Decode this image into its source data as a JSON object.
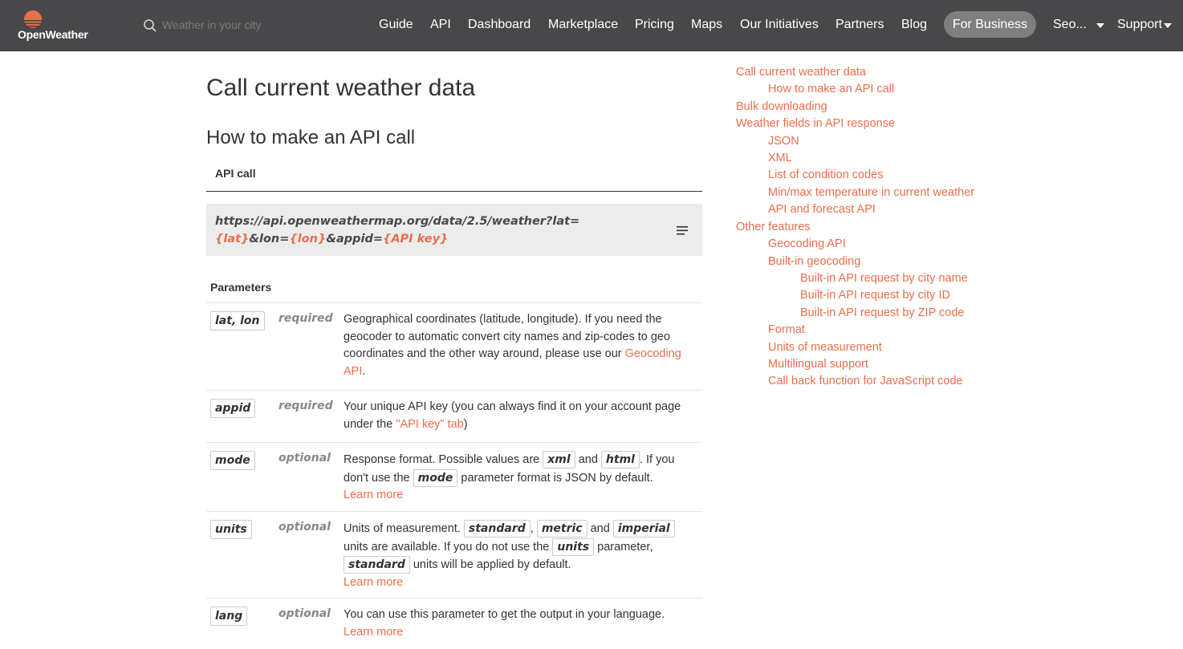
{
  "header": {
    "logo_text": "OpenWeather",
    "search_placeholder": "Weather in your city",
    "nav": [
      "Guide",
      "API",
      "Dashboard",
      "Marketplace",
      "Pricing",
      "Maps",
      "Our Initiatives",
      "Partners",
      "Blog"
    ],
    "business_button": "For Business",
    "user_menu": "Seo...",
    "support_menu": "Support",
    "colors": {
      "bar": "#48484a",
      "accent": "#eb6e4b"
    }
  },
  "main": {
    "title": "Call current weather data",
    "subtitle": "How to make an API call",
    "api_call_label": "API call",
    "api_url": {
      "part1": "https://api.openweathermap.org/data/2.5/weather?lat=",
      "lat": "{lat}",
      "part2": "&lon=",
      "lon": "{lon}",
      "part3": "&appid=",
      "key": "{API key}"
    },
    "parameters_label": "Parameters",
    "params": [
      {
        "name": "lat, lon",
        "req": "required",
        "desc": "Geographical coordinates (latitude, longitude). If you need the geocoder to automatic convert city names and zip-codes to geo coordinates and the other way around, please use our ",
        "link": "Geocoding API",
        "after": "."
      },
      {
        "name": "appid",
        "req": "required",
        "desc": "Your unique API key (you can always find it on your account page under the ",
        "link": "\"API key\" tab",
        "after": ")"
      },
      {
        "name": "mode",
        "req": "optional",
        "desc1": "Response format. Possible values are ",
        "tag1": "xml",
        "and": " and ",
        "tag2": "html",
        "desc2": ". If you don't use the ",
        "tag3": "mode",
        "desc3": " parameter format is JSON by default.",
        "link": "Learn more"
      },
      {
        "name": "units",
        "req": "optional",
        "desc1": "Units of measurement. ",
        "tag1": "standard",
        "comma": ", ",
        "tag2": "metric",
        "and": " and ",
        "tag3": "imperial",
        "desc2": " units are available. If you do not use the ",
        "tag4": "units",
        "desc3": " parameter, ",
        "tag5": "standard",
        "desc4": " units will be applied by default.",
        "link": "Learn more"
      },
      {
        "name": "lang",
        "req": "optional",
        "desc": "You can use this parameter to get the output in your language.",
        "link": "Learn more"
      }
    ]
  },
  "toc": [
    "Call current weather data",
    "How to make an API call",
    "Bulk downloading",
    "Weather fields in API response",
    "JSON",
    "XML",
    "List of condition codes",
    "Min/max temperature in current weather",
    "API and forecast API",
    "Other features",
    "Geocoding API",
    "Built-in geocoding",
    "Built-in API request by city name",
    "Built-in API request by city ID",
    "Built-in API request by ZIP code",
    "Format",
    "Units of measurement",
    "Multilingual support",
    "Call back function for JavaScript code"
  ]
}
